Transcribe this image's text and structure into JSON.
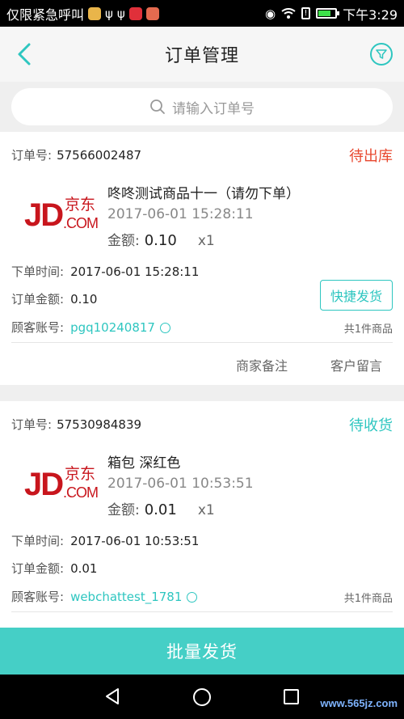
{
  "status_bar": {
    "left_text": "仅限紧急呼叫",
    "time": "下午3:29"
  },
  "header": {
    "title": "订单管理",
    "back_icon": "chevron-left-icon",
    "filter_icon": "filter-icon"
  },
  "search": {
    "placeholder": "请输入订单号"
  },
  "orders": [
    {
      "id_label": "订单号:",
      "id": "57566002487",
      "status": "待出库",
      "status_color": "#e8482f",
      "logo_jd": "JD",
      "logo_cn": "京东",
      "logo_com": ".COM",
      "product_name": "咚咚测试商品十一（请勿下单）",
      "product_time": "2017-06-01 15:28:11",
      "amount_label": "金额:",
      "amount": "0.10",
      "qty": "x1",
      "order_time_label": "下单时间:",
      "order_time": "2017-06-01 15:28:11",
      "order_amount_label": "订单金额:",
      "order_amount": "0.10",
      "customer_label": "顾客账号:",
      "customer": "pgq10240817",
      "quick_ship": "快捷发货",
      "item_count": "共1件商品",
      "merchant_note": "商家备注",
      "customer_message": "客户留言"
    },
    {
      "id_label": "订单号:",
      "id": "57530984839",
      "status": "待收货",
      "status_color": "#2ec6c0",
      "logo_jd": "JD",
      "logo_cn": "京东",
      "logo_com": ".COM",
      "product_name": "箱包 深红色",
      "product_time": "2017-06-01 10:53:51",
      "amount_label": "金额:",
      "amount": "0.01",
      "qty": "x1",
      "order_time_label": "下单时间:",
      "order_time": "2017-06-01 10:53:51",
      "order_amount_label": "订单金额:",
      "order_amount": "0.01",
      "customer_label": "顾客账号:",
      "customer": "webchattest_1781",
      "item_count": "共1件商品"
    }
  ],
  "bottom_action": {
    "label": "批量发货"
  },
  "watermark": "www.565jz.com",
  "colors": {
    "accent": "#2ec6c0",
    "alert": "#e8482f"
  }
}
